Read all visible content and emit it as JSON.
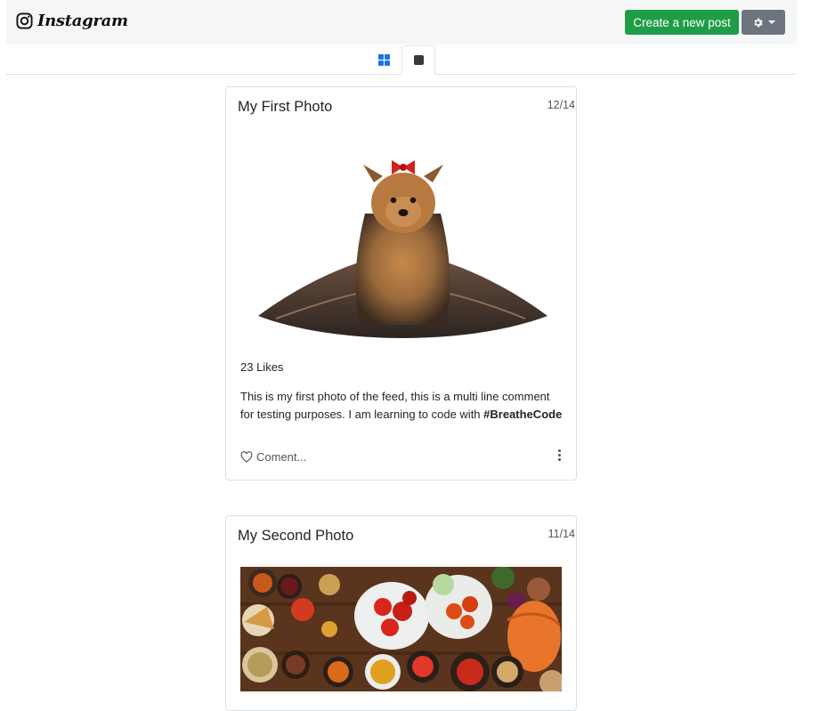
{
  "navbar": {
    "brand": "Instagram",
    "create_label": "Create a new post",
    "settings_icon": "gear-icon"
  },
  "tabs": [
    {
      "icon": "grid-view-icon",
      "active": false
    },
    {
      "icon": "single-view-icon",
      "active": true
    }
  ],
  "posts": [
    {
      "title": "My First Photo",
      "date": "12/14",
      "image": "yorkshire-terrier-photo",
      "likes": "23 Likes",
      "caption": "This is my first photo of the feed, this is a multi line comment for testing purposes. I am learning to code with",
      "hashtag": "#BreatheCode",
      "comment_placeholder": "Coment..."
    },
    {
      "title": "My Second Photo",
      "date": "11/14",
      "image": "indian-food-spread-photo"
    }
  ],
  "colors": {
    "create_button": "#1f9d46",
    "settings_button": "#6c757d",
    "grid_icon": "#1a73e8",
    "navbar_bg": "#f5f6f7"
  }
}
